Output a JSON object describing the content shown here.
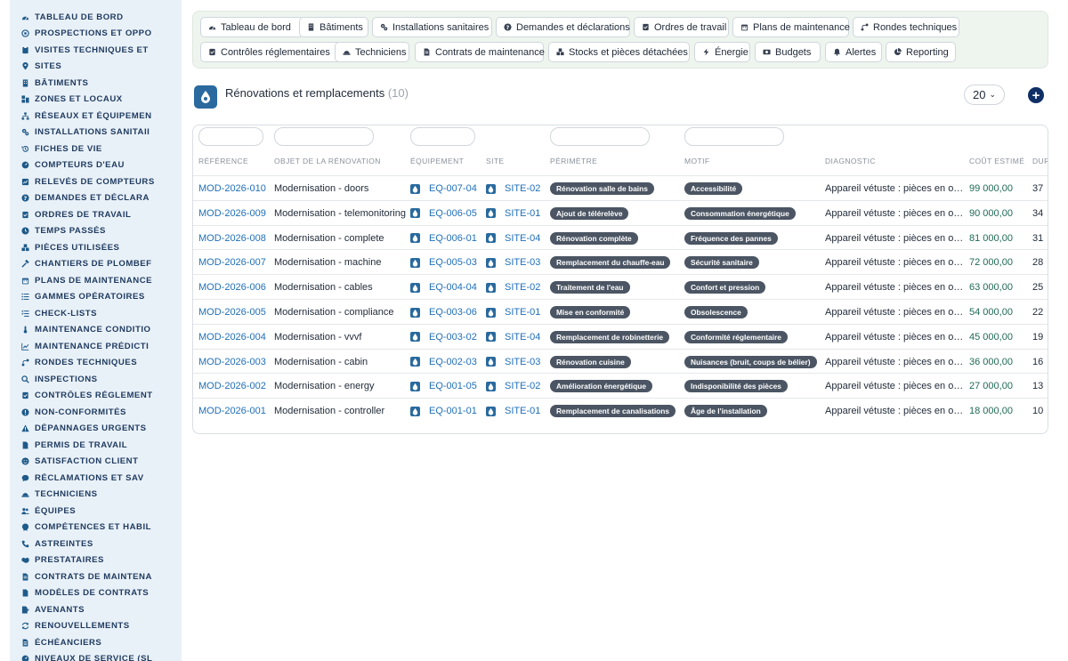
{
  "sidebar": {
    "items": [
      {
        "label": "TABLEAU DE BORD",
        "icon": "dashboard-icon"
      },
      {
        "label": "PROSPECTIONS ET OPPO",
        "icon": "target-icon"
      },
      {
        "label": "VISITES TECHNIQUES ET",
        "icon": "clipboard-icon"
      },
      {
        "label": "SITES",
        "icon": "location-pin-icon"
      },
      {
        "label": "BÂTIMENTS",
        "icon": "building-icon"
      },
      {
        "label": "ZONES ET LOCAUX",
        "icon": "zones-icon"
      },
      {
        "label": "RÉSEAUX ET ÉQUIPEMEN",
        "icon": "network-icon"
      },
      {
        "label": "INSTALLATIONS SANITAII",
        "icon": "gears-icon"
      },
      {
        "label": "FICHES DE VIE",
        "icon": "history-icon"
      },
      {
        "label": "COMPTEURS D'EAU",
        "icon": "gauge-icon"
      },
      {
        "label": "RELEVÉS DE COMPTEURS",
        "icon": "readings-icon"
      },
      {
        "label": "DEMANDES ET DÉCLARA",
        "icon": "question-icon"
      },
      {
        "label": "ORDRES DE TRAVAIL",
        "icon": "clipboard-check-icon"
      },
      {
        "label": "TEMPS PASSÉS",
        "icon": "clock-icon"
      },
      {
        "label": "PIÈCES UTILISÉES",
        "icon": "boxes-icon"
      },
      {
        "label": "CHANTIERS DE PLOMBEF",
        "icon": "hammer-icon"
      },
      {
        "label": "PLANS DE MAINTENANCE",
        "icon": "calendar-icon"
      },
      {
        "label": "GAMMES OPÉRATOIRES",
        "icon": "list-icon"
      },
      {
        "label": "CHECK-LISTS",
        "icon": "checklist-icon"
      },
      {
        "label": "MAINTENANCE CONDITIO",
        "icon": "thermometer-icon"
      },
      {
        "label": "MAINTENANCE PRÉDICTI",
        "icon": "chart-line-icon"
      },
      {
        "label": "RONDES TECHNIQUES",
        "icon": "route-icon"
      },
      {
        "label": "INSPECTIONS",
        "icon": "search-icon"
      },
      {
        "label": "CONTRÔLES RÉGLEMENT",
        "icon": "clipboard-check-icon"
      },
      {
        "label": "NON-CONFORMITÉS",
        "icon": "alert-circle-icon"
      },
      {
        "label": "DÉPANNAGES URGENTS",
        "icon": "warning-icon"
      },
      {
        "label": "PERMIS DE TRAVAIL",
        "icon": "file-icon"
      },
      {
        "label": "SATISFACTION CLIENT",
        "icon": "smile-icon"
      },
      {
        "label": "RÉCLAMATIONS ET SAV",
        "icon": "chat-icon"
      },
      {
        "label": "TECHNICIENS",
        "icon": "hard-hat-icon"
      },
      {
        "label": "ÉQUIPES",
        "icon": "users-icon"
      },
      {
        "label": "COMPÉTENCES ET HABIL",
        "icon": "certificate-icon"
      },
      {
        "label": "ASTREINTES",
        "icon": "phone-icon"
      },
      {
        "label": "PRESTATAIRES",
        "icon": "handshake-icon"
      },
      {
        "label": "CONTRATS DE MAINTENA",
        "icon": "file-contract-icon"
      },
      {
        "label": "MODÈLES DE CONTRATS",
        "icon": "file-icon"
      },
      {
        "label": "AVENANTS",
        "icon": "file-edit-icon"
      },
      {
        "label": "RENOUVELLEMENTS",
        "icon": "refresh-icon"
      },
      {
        "label": "ÉCHÉANCIERS",
        "icon": "file-lines-icon"
      },
      {
        "label": "NIVEAUX DE SERVICE (SL",
        "icon": "gauge-icon"
      }
    ]
  },
  "tabs": [
    {
      "label": "Tableau de bord",
      "icon": "dashboard-icon"
    },
    {
      "label": "Bâtiments",
      "icon": "building-icon"
    },
    {
      "label": "Installations sanitaires",
      "icon": "gears-icon"
    },
    {
      "label": "Demandes et déclarations",
      "icon": "question-icon"
    },
    {
      "label": "Ordres de travail",
      "icon": "clipboard-check-icon"
    },
    {
      "label": "Plans de maintenance",
      "icon": "calendar-icon"
    },
    {
      "label": "Rondes techniques",
      "icon": "route-icon"
    },
    {
      "label": "Contrôles réglementaires",
      "icon": "clipboard-check-icon"
    },
    {
      "label": "Techniciens",
      "icon": "hard-hat-icon"
    },
    {
      "label": "Contrats de maintenance",
      "icon": "file-contract-icon"
    },
    {
      "label": "Stocks et pièces détachées",
      "icon": "boxes-icon"
    },
    {
      "label": "Énergie",
      "icon": "bolt-icon"
    },
    {
      "label": "Budgets",
      "icon": "money-icon"
    },
    {
      "label": "Alertes",
      "icon": "bell-icon"
    },
    {
      "label": "Reporting",
      "icon": "pie-chart-icon"
    }
  ],
  "page": {
    "title": "Rénovations et remplacements",
    "count": "(10)",
    "per_page": "20"
  },
  "table": {
    "headers": [
      "RÉFÉRENCE",
      "OBJET DE LA RÉNOVATION",
      "ÉQUIPEMENT",
      "SITE",
      "PÉRIMÈTRE",
      "MOTIF",
      "DIAGNOSTIC",
      "COÛT ESTIMÉ",
      "DUR"
    ],
    "rows": [
      {
        "ref": "MOD-2026-010",
        "objet": "Modernisation - doors",
        "equip": "EQ-007-04",
        "site": "SITE-02",
        "perimetre": "Rénovation salle de bains",
        "motif": "Accessibilité",
        "diagnostic": "Appareil vétuste : pièces en o…",
        "cout": "99 000,00",
        "duree": "37"
      },
      {
        "ref": "MOD-2026-009",
        "objet": "Modernisation - telemonitoring",
        "equip": "EQ-006-05",
        "site": "SITE-01",
        "perimetre": "Ajout de télérelève",
        "motif": "Consommation énergétique",
        "diagnostic": "Appareil vétuste : pièces en o…",
        "cout": "90 000,00",
        "duree": "34"
      },
      {
        "ref": "MOD-2026-008",
        "objet": "Modernisation - complete",
        "equip": "EQ-006-01",
        "site": "SITE-04",
        "perimetre": "Rénovation complète",
        "motif": "Fréquence des pannes",
        "diagnostic": "Appareil vétuste : pièces en o…",
        "cout": "81 000,00",
        "duree": "31"
      },
      {
        "ref": "MOD-2026-007",
        "objet": "Modernisation - machine",
        "equip": "EQ-005-03",
        "site": "SITE-03",
        "perimetre": "Remplacement du chauffe-eau",
        "motif": "Sécurité sanitaire",
        "diagnostic": "Appareil vétuste : pièces en o…",
        "cout": "72 000,00",
        "duree": "28"
      },
      {
        "ref": "MOD-2026-006",
        "objet": "Modernisation - cables",
        "equip": "EQ-004-04",
        "site": "SITE-02",
        "perimetre": "Traitement de l'eau",
        "motif": "Confort et pression",
        "diagnostic": "Appareil vétuste : pièces en o…",
        "cout": "63 000,00",
        "duree": "25"
      },
      {
        "ref": "MOD-2026-005",
        "objet": "Modernisation - compliance",
        "equip": "EQ-003-06",
        "site": "SITE-01",
        "perimetre": "Mise en conformité",
        "motif": "Obsolescence",
        "diagnostic": "Appareil vétuste : pièces en o…",
        "cout": "54 000,00",
        "duree": "22"
      },
      {
        "ref": "MOD-2026-004",
        "objet": "Modernisation - vvvf",
        "equip": "EQ-003-02",
        "site": "SITE-04",
        "perimetre": "Remplacement de robinetterie",
        "motif": "Conformité réglementaire",
        "diagnostic": "Appareil vétuste : pièces en o…",
        "cout": "45 000,00",
        "duree": "19"
      },
      {
        "ref": "MOD-2026-003",
        "objet": "Modernisation - cabin",
        "equip": "EQ-002-03",
        "site": "SITE-03",
        "perimetre": "Rénovation cuisine",
        "motif": "Nuisances (bruit, coups de bélier)",
        "diagnostic": "Appareil vétuste : pièces en o…",
        "cout": "36 000,00",
        "duree": "16"
      },
      {
        "ref": "MOD-2026-002",
        "objet": "Modernisation - energy",
        "equip": "EQ-001-05",
        "site": "SITE-02",
        "perimetre": "Amélioration énergétique",
        "motif": "Indisponibilité des pièces",
        "diagnostic": "Appareil vétuste : pièces en o…",
        "cout": "27 000,00",
        "duree": "13"
      },
      {
        "ref": "MOD-2026-001",
        "objet": "Modernisation - controller",
        "equip": "EQ-001-01",
        "site": "SITE-01",
        "perimetre": "Remplacement de canalisations",
        "motif": "Âge de l'installation",
        "diagnostic": "Appareil vétuste : pièces en o…",
        "cout": "18 000,00",
        "duree": "10"
      }
    ]
  },
  "colors": {
    "sidebar_bg": "#e9f1f8",
    "sidebar_text": "#1e3a5f",
    "link": "#1f6fb8",
    "pill_bg": "#4b5563",
    "cost": "#1f6a55",
    "tabbar_bg": "#eef5ee",
    "accent": "#0f2f66"
  }
}
